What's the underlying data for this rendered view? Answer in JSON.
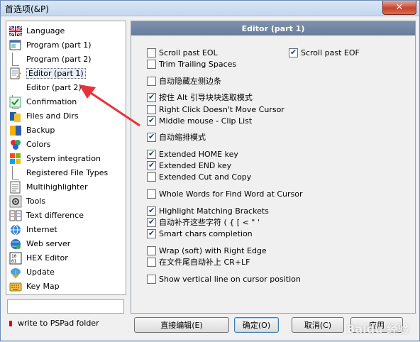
{
  "window": {
    "title": "首选项(&P)",
    "close_glyph": "✕"
  },
  "tree": {
    "items": [
      {
        "label": "Language",
        "icon": "uk-flag-icon"
      },
      {
        "label": "Program  (part 1)",
        "icon": "program-icon"
      },
      {
        "label": "Program  (part 2)",
        "icon": ""
      },
      {
        "label": "Editor  (part 1)",
        "icon": "editor-icon"
      },
      {
        "label": "Editor  (part 2)",
        "icon": ""
      },
      {
        "label": "Confirmation",
        "icon": "confirmation-icon"
      },
      {
        "label": "Files and Dirs",
        "icon": "files-icon"
      },
      {
        "label": "Backup",
        "icon": "backup-icon"
      },
      {
        "label": "Colors",
        "icon": "colors-icon"
      },
      {
        "label": "System integration",
        "icon": "windows-icon"
      },
      {
        "label": "Registered File Types",
        "icon": ""
      },
      {
        "label": "Multihighlighter",
        "icon": "multihighlighter-icon"
      },
      {
        "label": "Tools",
        "icon": "tools-icon"
      },
      {
        "label": "Text difference",
        "icon": "text-diff-icon"
      },
      {
        "label": "Internet",
        "icon": "internet-icon"
      },
      {
        "label": "Web server",
        "icon": "web-server-icon"
      },
      {
        "label": "HEX Editor",
        "icon": "hex-icon"
      },
      {
        "label": "Update",
        "icon": "update-icon"
      },
      {
        "label": "Key Map",
        "icon": "keyboard-icon"
      }
    ],
    "filter_value": "",
    "pspad_note": "write to PSPad folder"
  },
  "panel": {
    "header": "Editor  (part 1)",
    "options": [
      {
        "label": "Scroll past EOL",
        "checked": false
      },
      {
        "label": "Scroll past EOF",
        "checked": true
      },
      {
        "label": "Trim Trailing Spaces",
        "checked": false
      },
      {
        "label": "自动隐藏左侧边条",
        "checked": false
      },
      {
        "label": "按住 Alt 引导块块选取模式",
        "checked": true
      },
      {
        "label": "Right Click Doesn't Move Cursor",
        "checked": false
      },
      {
        "label": "Middle mouse - Clip List",
        "checked": true
      },
      {
        "label": "自动缩排模式",
        "checked": true
      },
      {
        "label": "Extended HOME key",
        "checked": true
      },
      {
        "label": "Extended END key",
        "checked": true
      },
      {
        "label": "Extended Cut and Copy",
        "checked": false
      },
      {
        "label": "Whole Words for Find Word at Cursor",
        "checked": false
      },
      {
        "label": "Highlight Matching Brackets",
        "checked": true
      },
      {
        "label": "自动补齐这些字符 ( { [ < \" '",
        "checked": true
      },
      {
        "label": "Smart chars completion",
        "checked": true
      },
      {
        "label": "Wrap (soft) with Right Edge",
        "checked": false
      },
      {
        "label": "在文件尾自动补上 CR+LF",
        "checked": false
      },
      {
        "label": "Show vertical line on cursor position",
        "checked": false
      }
    ]
  },
  "buttons": {
    "direct_edit": "直接编辑(E)",
    "ok": "确定(O)",
    "cancel": "取消(C)",
    "apply": "应用"
  },
  "watermark": "Baidu 经验",
  "colors": {
    "header_bg": "#6f84a2",
    "close_bg": "#c7432b",
    "arrow": "#e8323a"
  }
}
